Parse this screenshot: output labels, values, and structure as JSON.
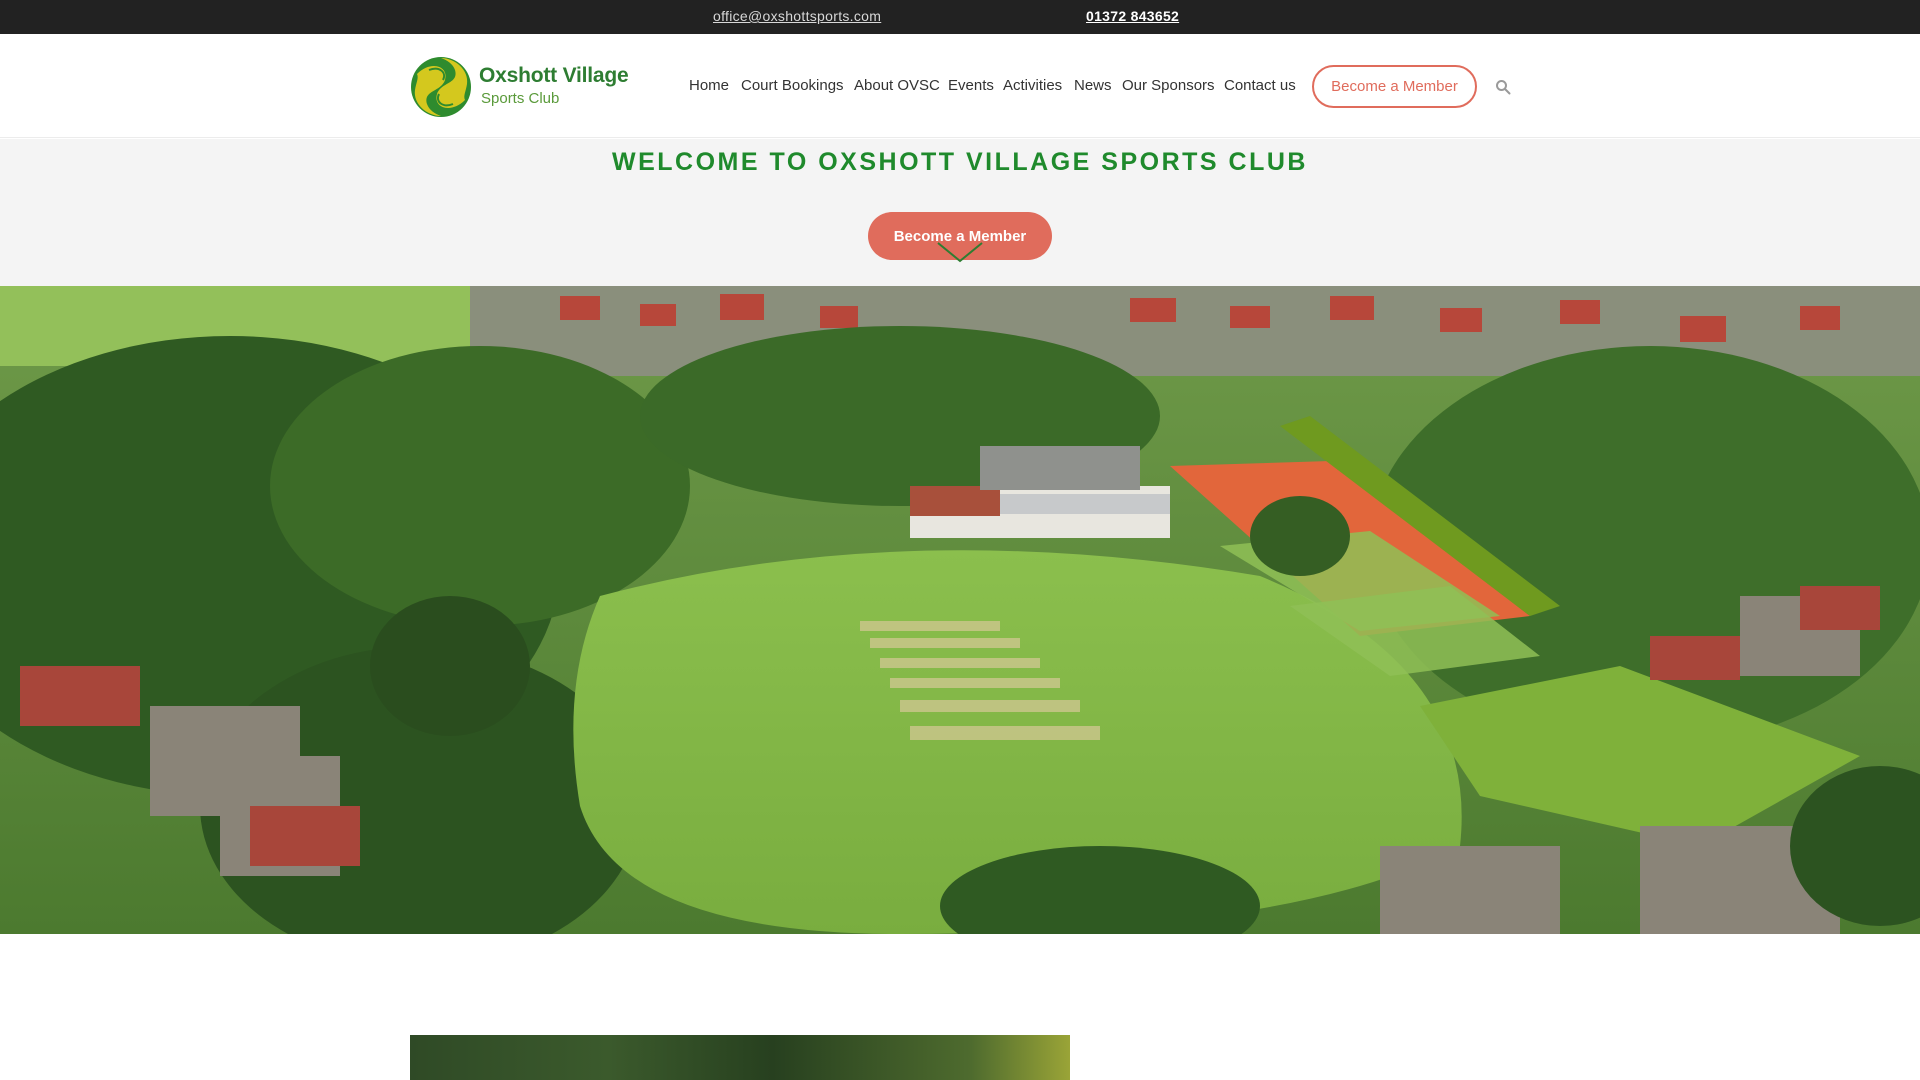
{
  "topbar": {
    "email": "office@oxshottsports.com",
    "phone": "01372 843652"
  },
  "header": {
    "logo": {
      "title": "Oxshott Village",
      "subtitle": "Sports Club"
    },
    "nav": [
      {
        "label": "Home"
      },
      {
        "label": "Court Bookings"
      },
      {
        "label": "About OVSC"
      },
      {
        "label": "Events"
      },
      {
        "label": "Activities"
      },
      {
        "label": "News"
      },
      {
        "label": "Our Sponsors"
      },
      {
        "label": "Contact us"
      }
    ],
    "cta_label": "Become a Member",
    "search_icon": "search-icon"
  },
  "welcome": {
    "title": "WELCOME TO OXSHOTT VILLAGE SPORTS CLUB",
    "cta_label": "Become a Member",
    "scroll_icon": "chevron-down-icon"
  },
  "colors": {
    "topbar_bg": "#222222",
    "brand_green": "#1f8a2c",
    "accent": "#e06c5c",
    "logo_yellow": "#c9c21a"
  }
}
